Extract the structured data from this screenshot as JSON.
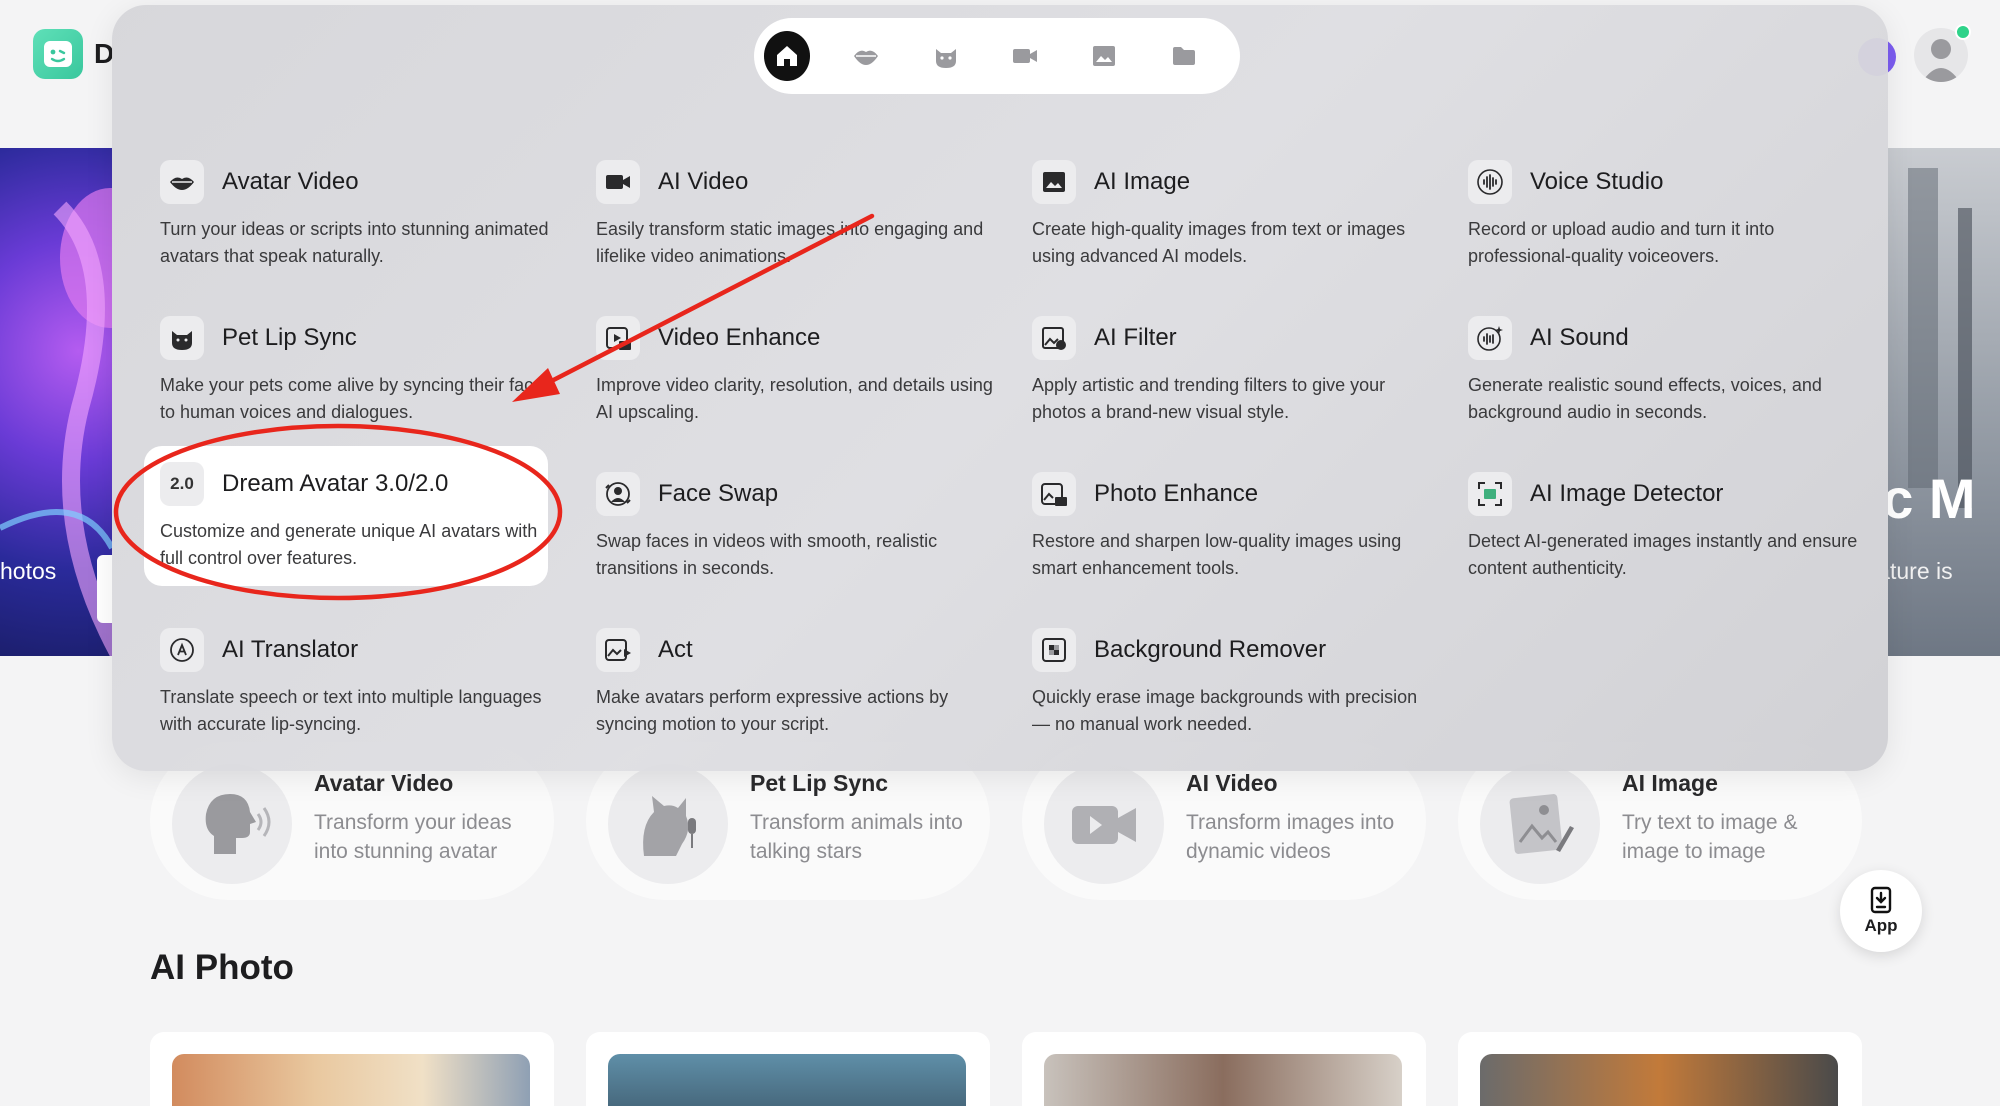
{
  "app": {
    "logo_text": "D"
  },
  "banner": {
    "left_text": "hotos",
    "right_title": "tic M",
    "right_subtitle": "feature is"
  },
  "menu": {
    "categories": [
      {
        "icon": "home-icon",
        "active": true
      },
      {
        "icon": "lips-icon",
        "active": false
      },
      {
        "icon": "cat-icon",
        "active": false
      },
      {
        "icon": "video-camera-icon",
        "active": false
      },
      {
        "icon": "image-icon",
        "active": false
      },
      {
        "icon": "folder-icon",
        "active": false
      }
    ],
    "items": [
      {
        "title": "Avatar Video",
        "desc": "Turn your ideas or scripts into stunning animated avatars that speak naturally.",
        "icon": "lips-icon"
      },
      {
        "title": "AI Video",
        "desc": "Easily transform static images into engaging and lifelike video animations.",
        "icon": "video-camera-icon"
      },
      {
        "title": "AI Image",
        "desc": "Create high-quality images from text or images using advanced AI models.",
        "icon": "image-icon"
      },
      {
        "title": "Voice Studio",
        "desc": "Record or upload audio and turn it into professional-quality voiceovers.",
        "icon": "waveform-icon"
      },
      {
        "title": "Pet Lip Sync",
        "desc": "Make your pets come alive by syncing their faces to human voices and dialogues.",
        "icon": "cat-icon"
      },
      {
        "title": "Video Enhance",
        "desc": "Improve video clarity, resolution, and details using AI upscaling.",
        "icon": "video-hd-icon"
      },
      {
        "title": "AI Filter",
        "desc": "Apply artistic and trending filters to give your photos a brand-new visual style.",
        "icon": "filter-icon"
      },
      {
        "title": "AI Sound",
        "desc": "Generate realistic sound effects, voices, and background audio in seconds.",
        "icon": "sound-sparkle-icon"
      },
      {
        "title": "Dream Avatar 3.0/2.0",
        "desc": "Customize and generate unique AI avatars with full control over features.",
        "icon": "version-badge-icon",
        "badge": "2.0"
      },
      {
        "title": "Face Swap",
        "desc": "Swap faces in videos with smooth, realistic transitions in seconds.",
        "icon": "face-swap-icon"
      },
      {
        "title": "Photo Enhance",
        "desc": "Restore and sharpen low-quality images using smart enhancement tools.",
        "icon": "image-hd-icon"
      },
      {
        "title": "AI Image Detector",
        "desc": "Detect AI-generated images instantly and ensure content authenticity.",
        "icon": "ai-scan-icon"
      },
      {
        "title": "AI Translator",
        "desc": "Translate speech or text into multiple languages with accurate lip-syncing.",
        "icon": "translate-icon"
      },
      {
        "title": "Act",
        "desc": "Make avatars perform expressive actions by syncing motion to your script.",
        "icon": "act-icon"
      },
      {
        "title": "Background Remover",
        "desc": "Quickly erase image backgrounds with precision — no manual work needed.",
        "icon": "background-remove-icon"
      }
    ]
  },
  "features": [
    {
      "title": "Avatar Video",
      "desc": "Transform your ideas into stunning avatar",
      "icon": "speaking-head-icon"
    },
    {
      "title": "Pet Lip Sync",
      "desc": "Transform animals into talking stars",
      "icon": "dog-microphone-icon"
    },
    {
      "title": "AI Video",
      "desc": "Transform images into dynamic videos",
      "icon": "video-camera-icon"
    },
    {
      "title": "AI Image",
      "desc": "Try text to image & image to image",
      "icon": "image-pencil-icon"
    }
  ],
  "app_button": {
    "label": "App"
  },
  "section": {
    "title": "AI Photo"
  },
  "colors": {
    "annotation": "#e8261c",
    "accent": "#3fd3a6",
    "online": "#2fd38a"
  }
}
